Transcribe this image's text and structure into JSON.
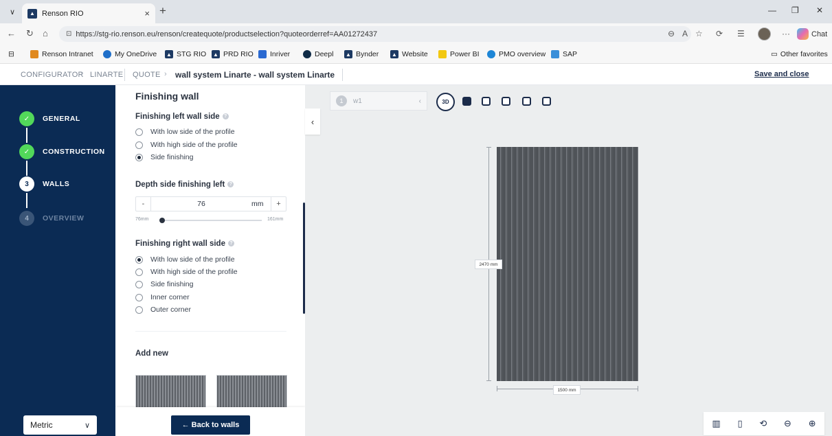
{
  "browser": {
    "tab_title": "Renson RIO",
    "tab_close": "×",
    "new_tab": "+",
    "url": "https://stg-rio.renson.eu/renson/createquote/productselection?quoteorderref=AA01272437",
    "chat_label": "Chat",
    "favorites": [
      {
        "label": "Renson Intranet",
        "color": "#e0891f"
      },
      {
        "label": "My OneDrive",
        "color": "#1f6fc9"
      },
      {
        "label": "STG RIO",
        "color": "#1d3a63"
      },
      {
        "label": "PRD RIO",
        "color": "#1d3a63"
      },
      {
        "label": "Inriver",
        "color": "#2b6ad1"
      },
      {
        "label": "Deepl",
        "color": "#0f2b46"
      },
      {
        "label": "Bynder",
        "color": "#1d3a63"
      },
      {
        "label": "Website",
        "color": "#1d3a63"
      },
      {
        "label": "Power BI",
        "color": "#f2c811"
      },
      {
        "label": "PMO overview",
        "color": "#1e86d6"
      },
      {
        "label": "SAP",
        "color": "#3a8fd9"
      }
    ],
    "other_favorites": "Other favorites"
  },
  "header": {
    "crumb_configurator": "CONFIGURATOR",
    "crumb_linarte": "LINARTE",
    "crumb_quote": "QUOTE",
    "current": "wall system Linarte - wall system Linarte",
    "save_close": "Save and close"
  },
  "stepper": {
    "steps": [
      {
        "num": "✓",
        "label": "GENERAL",
        "state": "done"
      },
      {
        "num": "✓",
        "label": "CONSTRUCTION",
        "state": "done"
      },
      {
        "num": "3",
        "label": "WALLS",
        "state": "active"
      },
      {
        "num": "4",
        "label": "OVERVIEW",
        "state": "todo"
      }
    ]
  },
  "units": {
    "selected": "Metric"
  },
  "form": {
    "title": "Finishing wall",
    "left_side_title": "Finishing left wall side",
    "left_options": [
      "With low side of the profile",
      "With high side of the profile",
      "Side finishing"
    ],
    "left_selected": 2,
    "depth_title": "Depth side finishing left",
    "depth_value": "76",
    "depth_unit": "mm",
    "stepper_minus": "-",
    "stepper_plus": "+",
    "range_min": "76mm",
    "range_max": "161mm",
    "slider_fraction": 0,
    "right_side_title": "Finishing right wall side",
    "right_options": [
      "With low side of the profile",
      "With high side of the profile",
      "Side finishing",
      "Inner corner",
      "Outer corner"
    ],
    "right_selected": 0,
    "add_new": "Add new",
    "back_button": "← Back to walls"
  },
  "viewer": {
    "wall_number": "1",
    "wall_name": "w1",
    "view_3d_label": "3D",
    "height_label": "2470 mm",
    "width_label": "1500 mm",
    "icons": [
      "columns-icon",
      "rectangle-icon",
      "rotate-icon",
      "zoom-out-icon",
      "zoom-in-icon"
    ]
  }
}
